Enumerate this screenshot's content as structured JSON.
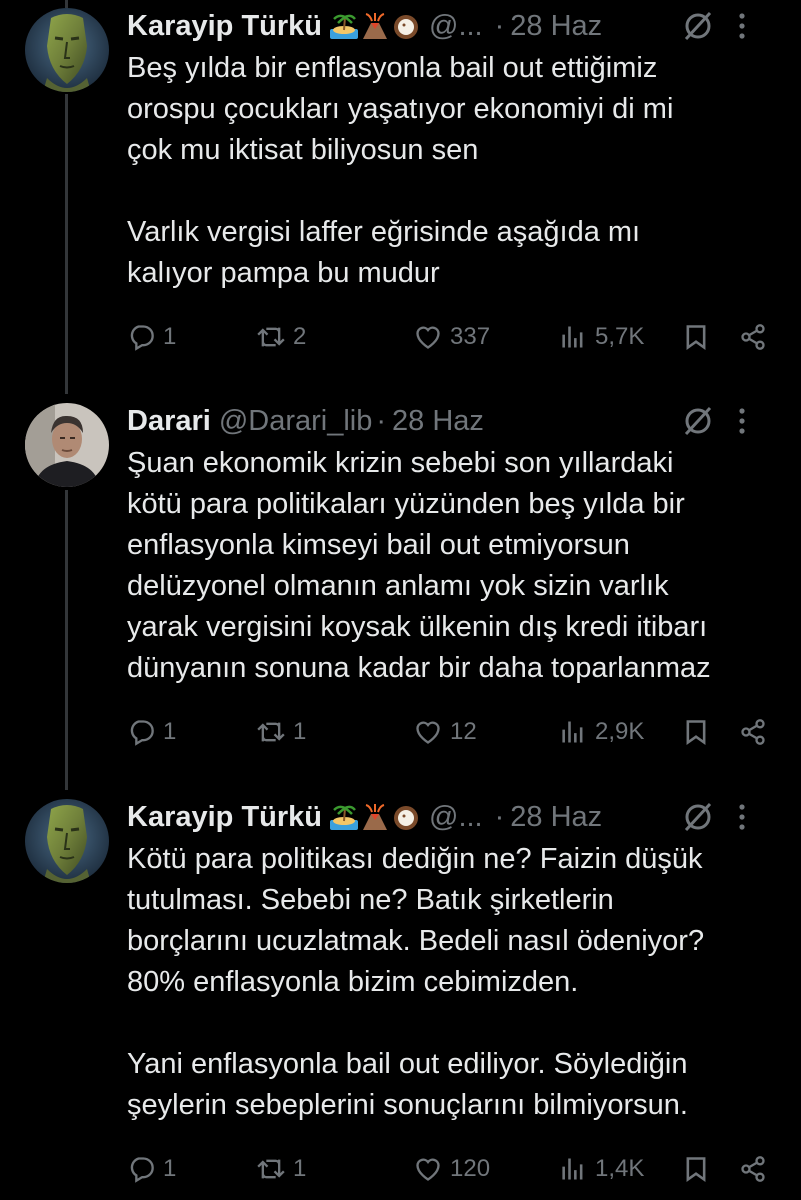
{
  "tweets": [
    {
      "name": "Karayip Türkü",
      "emojis": [
        "beach-island-emoji",
        "volcano-emoji",
        "coconut-emoji"
      ],
      "handle": "@...",
      "date": "28 Haz",
      "text": "Beş yılda bir enflasyonla bail out ettiğimiz\norospu çocukları yaşatıyor ekonomiyi di mi\nçok mu iktisat biliyosun sen\n\nVarlık vergisi laffer eğrisinde aşağıda mı\nkalıyor pampa bu mudur",
      "replies": "1",
      "retweets": "2",
      "likes": "337",
      "views": "5,7K"
    },
    {
      "name": "Darari",
      "handle": "@Darari_lib",
      "date": "28 Haz",
      "text": "Şuan ekonomik krizin sebebi son yıllardaki\nkötü para politikaları yüzünden beş yılda bir\nenflasyonla kimseyi bail out etmiyorsun\ndelüzyonel olmanın anlamı yok sizin varlık\nyarak vergisini koysak ülkenin dış kredi itibarı\ndünyanın sonuna kadar bir daha toparlanmaz",
      "replies": "1",
      "retweets": "1",
      "likes": "12",
      "views": "2,9K"
    },
    {
      "name": "Karayip Türkü",
      "emojis": [
        "beach-island-emoji",
        "volcano-emoji",
        "coconut-emoji"
      ],
      "handle": "@...",
      "date": "28 Haz",
      "text": "Kötü para politikası dediğin ne? Faizin düşük\ntutulması. Sebebi ne? Batık şirketlerin\nborçlarını ucuzlatmak. Bedeli nasıl ödeniyor?\n80% enflasyonla bizim cebimizden.\n\nYani enflasyonla bail out ediliyor. Söylediğin\nşeylerin sebeplerini sonuçlarını bilmiyorsun.",
      "replies": "1",
      "retweets": "1",
      "likes": "120",
      "views": "1,4K"
    }
  ],
  "colors": {
    "background": "#000000",
    "text": "#e7e9ea",
    "muted": "#71767b",
    "thread_line": "#333639"
  }
}
